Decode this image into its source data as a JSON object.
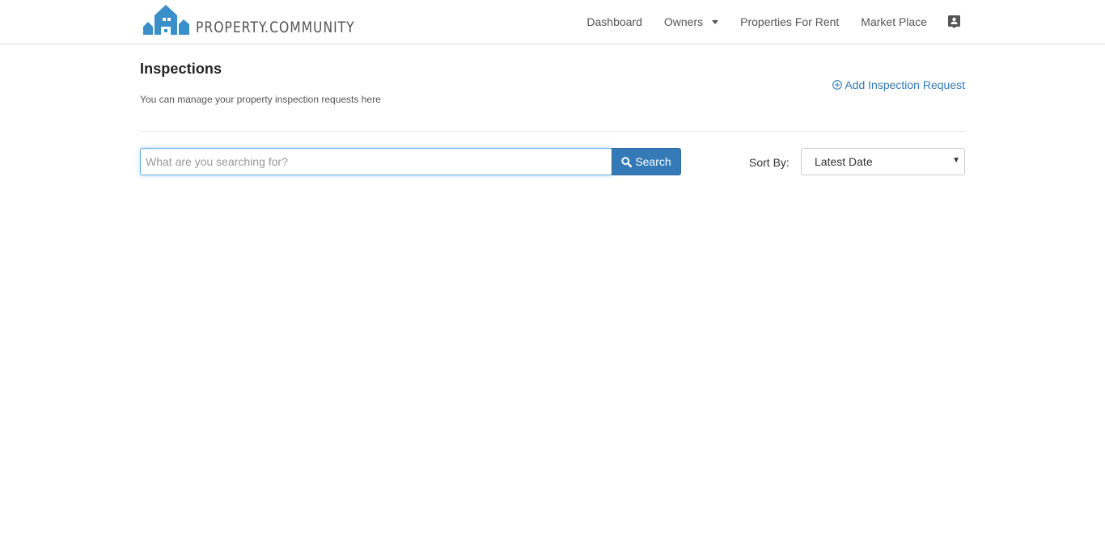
{
  "brand": {
    "name": "PROPERTY.COMMUNITY",
    "color": "#3a8fc8"
  },
  "nav": {
    "items": [
      {
        "label": "Dashboard"
      },
      {
        "label": "Owners",
        "icon": "caret-down-icon"
      },
      {
        "label": "Properties For Rent"
      },
      {
        "label": "Market Place"
      }
    ],
    "profile_icon": "contact-card-icon"
  },
  "page": {
    "title": "Inspections",
    "subtitle": "You can manage your property inspection requests here",
    "add_link": {
      "label": "Add Inspection Request",
      "icon": "plus-circle-icon"
    }
  },
  "search": {
    "placeholder": "What are you searching for?",
    "value": "",
    "button_label": "Search",
    "button_icon": "search-icon"
  },
  "sort": {
    "label": "Sort By:",
    "selected": "Latest Date"
  },
  "colors": {
    "accent": "#337ab7",
    "focus": "#66afe9"
  }
}
